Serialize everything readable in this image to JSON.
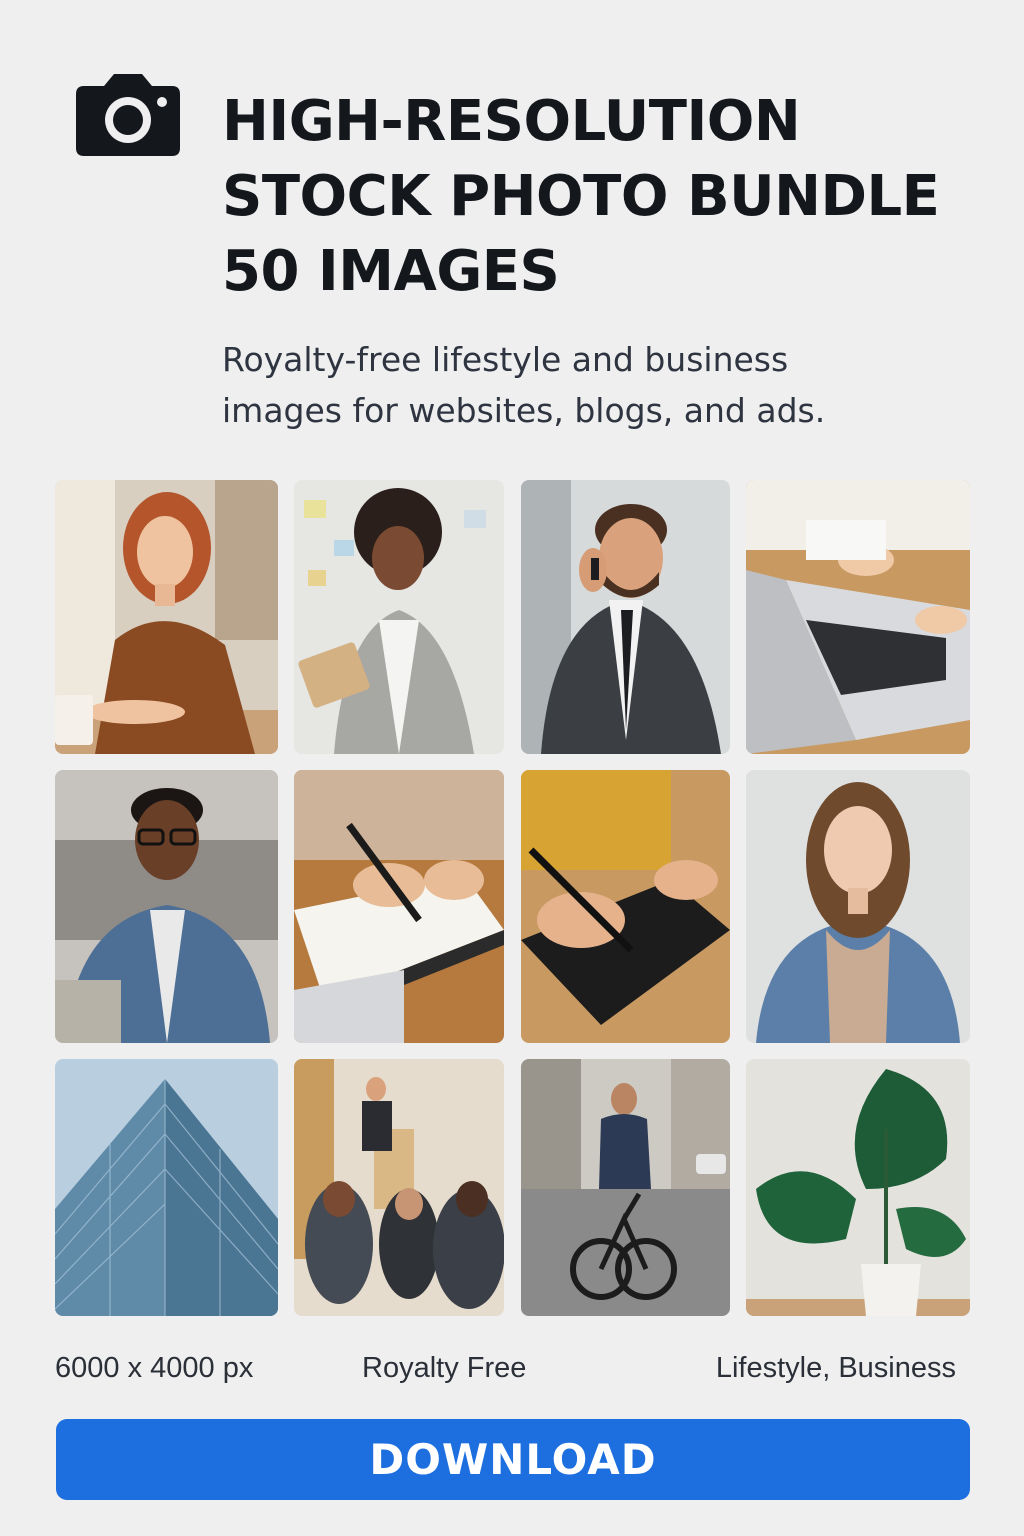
{
  "header": {
    "icon": "camera-icon",
    "title_lines": [
      "HIGH-RESOLUTION",
      "STOCK PHOTO BUNDLE",
      "50 IMAGES"
    ],
    "subtitle_lines": [
      "Royalty-free lifestyle and business",
      "images for websites, blogs, and ads."
    ]
  },
  "gallery": {
    "photos": [
      {
        "subject": "woman-with-red-hair-photo"
      },
      {
        "subject": "businesswoman-with-clipboard-photo"
      },
      {
        "subject": "businessman-on-phone-photo"
      },
      {
        "subject": "hands-on-laptop-photo"
      },
      {
        "subject": "smiling-man-with-glasses-photo"
      },
      {
        "subject": "hand-writing-in-notebook-photo"
      },
      {
        "subject": "hand-drawing-on-tablet-photo"
      },
      {
        "subject": "woman-in-denim-jacket-photo"
      },
      {
        "subject": "glass-office-building-photo"
      },
      {
        "subject": "conference-presentation-photo"
      },
      {
        "subject": "man-riding-bicycle-photo"
      },
      {
        "subject": "monstera-plant-photo"
      }
    ]
  },
  "meta": {
    "resolution": "6000 x 4000 px",
    "license": "Royalty Free",
    "categories": "Lifestyle, Business"
  },
  "actions": {
    "download_label": "DOWNLOAD"
  },
  "colors": {
    "background": "#efeff0",
    "title": "#14171c",
    "button": "#1d6fe0",
    "button_text": "#ffffff"
  }
}
